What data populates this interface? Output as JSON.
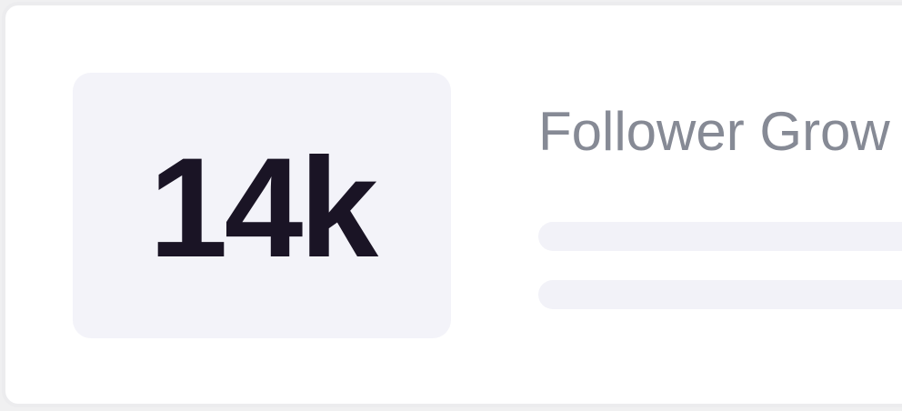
{
  "stat": {
    "value": "14k"
  },
  "card": {
    "title": "Follower Grow"
  },
  "colors": {
    "value_text": "#1a1425",
    "title_text": "#868a95",
    "tile_bg": "#f3f3f9",
    "placeholder_bar": "#f2f2f8"
  }
}
